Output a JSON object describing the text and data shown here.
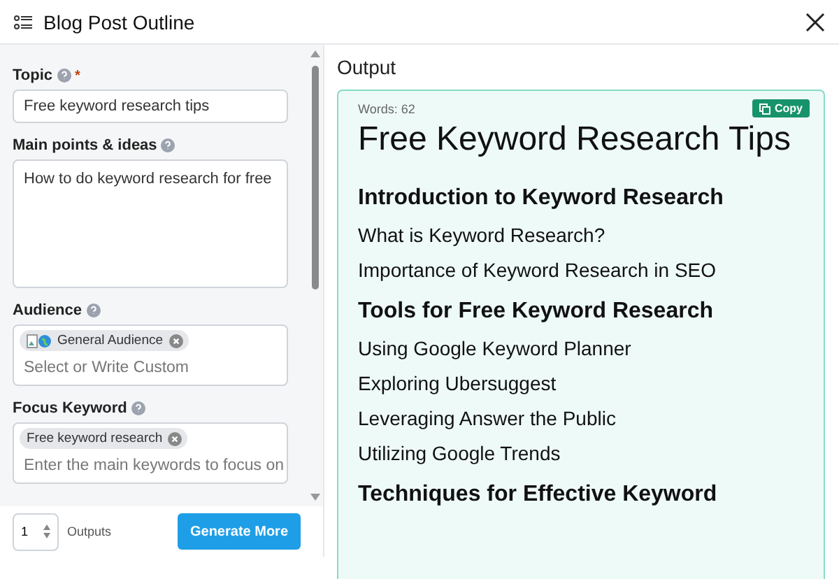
{
  "window": {
    "title": "Blog Post Outline"
  },
  "form": {
    "topic": {
      "label": "Topic",
      "required": "*",
      "value": "Free keyword research tips"
    },
    "main_points": {
      "label": "Main points & ideas",
      "value": "How to do keyword research for free"
    },
    "audience": {
      "label": "Audience",
      "tags": [
        "General Audience"
      ],
      "placeholder": "Select or Write Custom"
    },
    "focus_keyword": {
      "label": "Focus Keyword",
      "tags": [
        "Free keyword research"
      ],
      "placeholder": "Enter the main keywords to focus on"
    }
  },
  "footer": {
    "outputs_count": "1",
    "outputs_label": "Outputs",
    "generate_button": "Generate More"
  },
  "output": {
    "title": "Output",
    "word_count": "Words: 62",
    "copy_button": "Copy",
    "outline": [
      {
        "kind": "h1",
        "text": "Free Keyword Research Tips"
      },
      {
        "kind": "h2",
        "text": "Introduction to Keyword Research"
      },
      {
        "kind": "h3",
        "text": "What is Keyword Research?"
      },
      {
        "kind": "h3",
        "text": "Importance of Keyword Research in SEO"
      },
      {
        "kind": "h2",
        "text": "Tools for Free Keyword Research"
      },
      {
        "kind": "h3",
        "text": "Using Google Keyword Planner"
      },
      {
        "kind": "h3",
        "text": "Exploring Ubersuggest"
      },
      {
        "kind": "h3",
        "text": "Leveraging Answer the Public"
      },
      {
        "kind": "h3",
        "text": "Utilizing Google Trends"
      },
      {
        "kind": "h2",
        "text": "Techniques for Effective Keyword"
      }
    ]
  }
}
